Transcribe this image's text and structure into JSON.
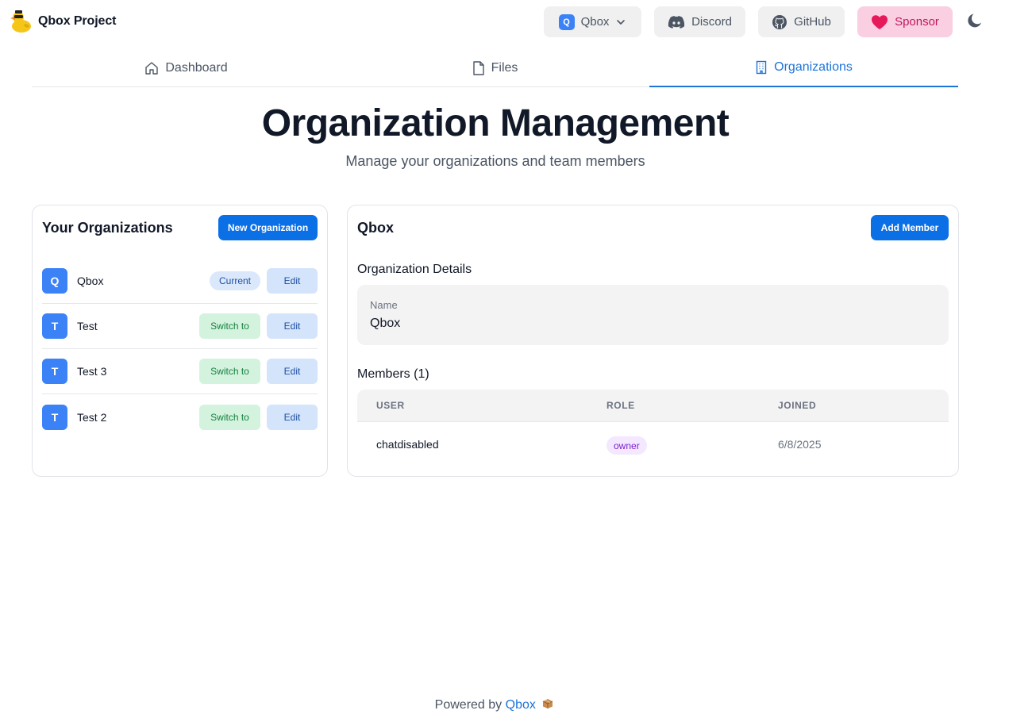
{
  "header": {
    "brand": "Qbox Project",
    "org_selector": {
      "initial": "Q",
      "label": "Qbox"
    },
    "discord_label": "Discord",
    "github_label": "GitHub",
    "sponsor_label": "Sponsor"
  },
  "tabs": [
    {
      "label": "Dashboard",
      "icon": "home-icon"
    },
    {
      "label": "Files",
      "icon": "file-icon"
    },
    {
      "label": "Organizations",
      "icon": "building-icon",
      "active": true
    }
  ],
  "page": {
    "title": "Organization Management",
    "subtitle": "Manage your organizations and team members"
  },
  "organizations_panel": {
    "title": "Your Organizations",
    "new_button": "New Organization",
    "items": [
      {
        "initial": "Q",
        "name": "Qbox",
        "status": "Current",
        "edit": "Edit"
      },
      {
        "initial": "T",
        "name": "Test",
        "action": "Switch to",
        "edit": "Edit"
      },
      {
        "initial": "T",
        "name": "Test 3",
        "action": "Switch to",
        "edit": "Edit"
      },
      {
        "initial": "T",
        "name": "Test 2",
        "action": "Switch to",
        "edit": "Edit"
      }
    ]
  },
  "detail_panel": {
    "title": "Qbox",
    "add_member_button": "Add Member",
    "details_heading": "Organization Details",
    "name_label": "Name",
    "name_value": "Qbox",
    "members_heading": "Members (1)",
    "columns": [
      "USER",
      "ROLE",
      "JOINED"
    ],
    "members": [
      {
        "user": "chatdisabled",
        "role": "owner",
        "joined": "6/8/2025"
      }
    ]
  },
  "footer": {
    "prefix": "Powered by",
    "link": "Qbox"
  },
  "colors": {
    "accent": "#0b6fe6",
    "sponsor_bg": "#fbcfe2",
    "switch_bg": "#d4f3df",
    "edit_bg": "#d4e4fb"
  }
}
